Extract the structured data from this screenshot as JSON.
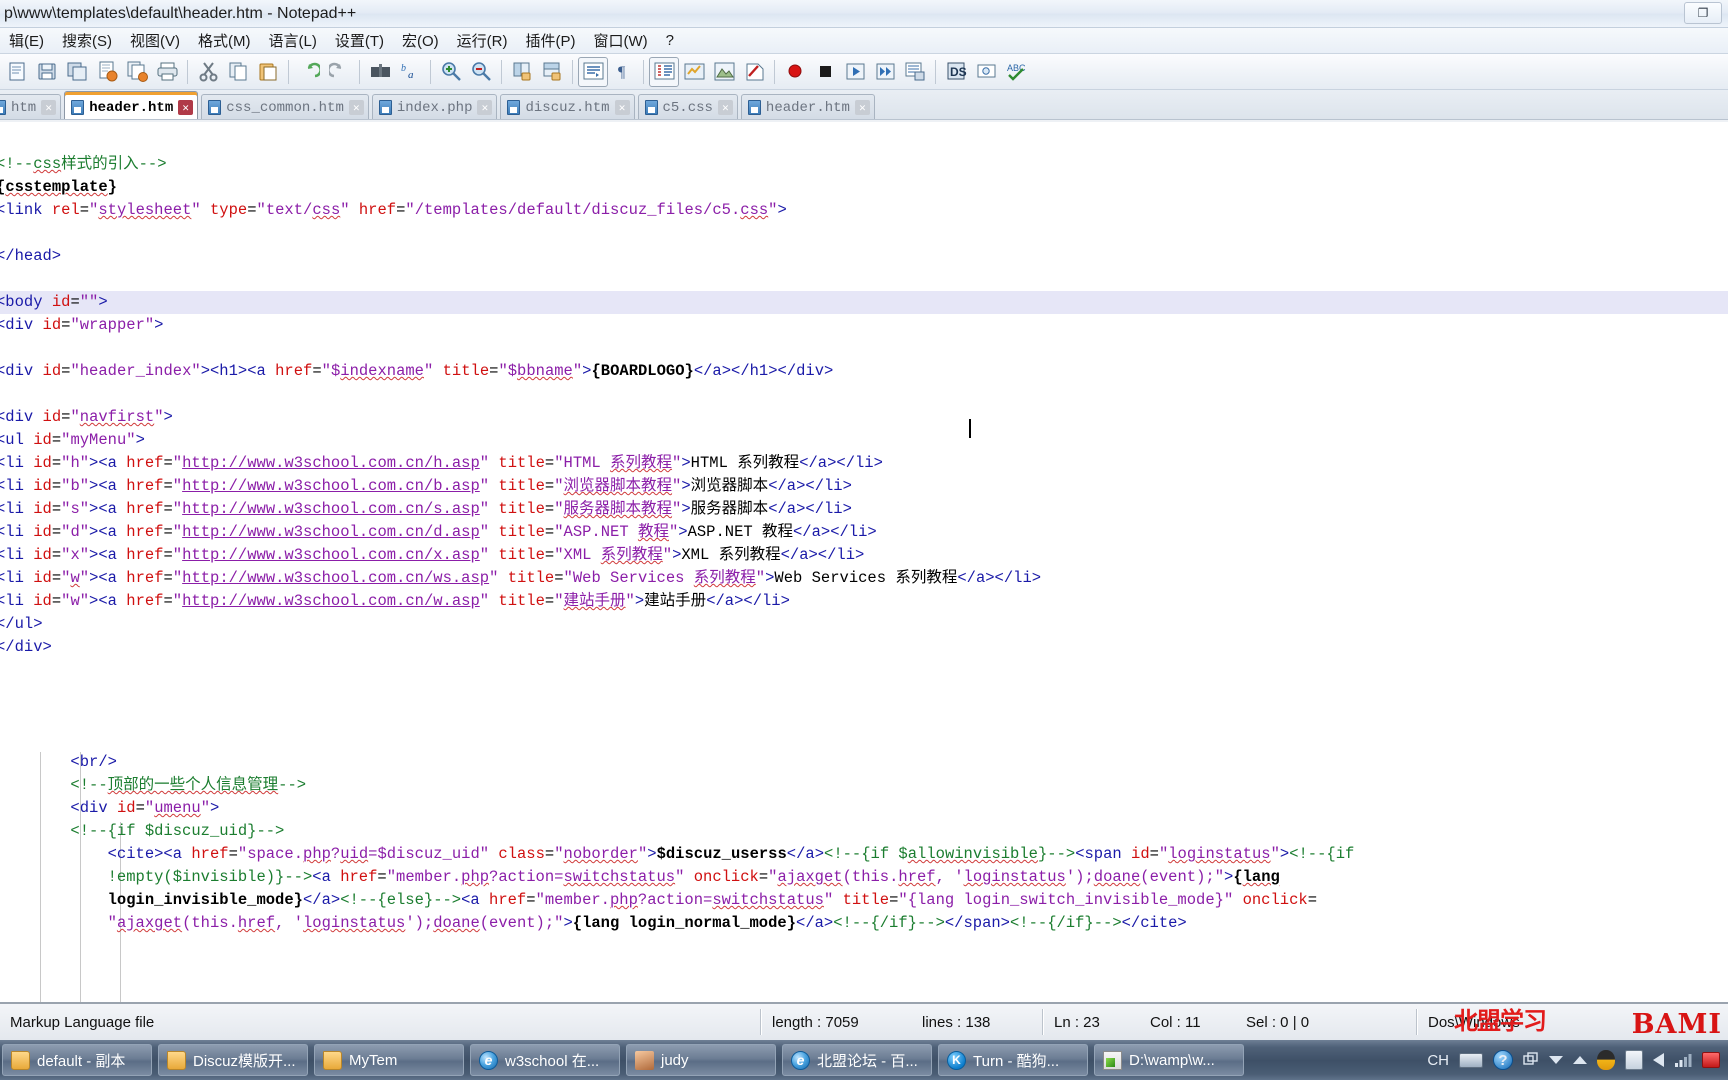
{
  "window": {
    "title": "p\\www\\templates\\default\\header.htm - Notepad++",
    "restore_label": "❐"
  },
  "menu": {
    "items": [
      {
        "label": "辑(E)",
        "name": "menu-edit"
      },
      {
        "label": "搜索(S)",
        "name": "menu-search"
      },
      {
        "label": "视图(V)",
        "name": "menu-view"
      },
      {
        "label": "格式(M)",
        "name": "menu-format"
      },
      {
        "label": "语言(L)",
        "name": "menu-language"
      },
      {
        "label": "设置(T)",
        "name": "menu-settings"
      },
      {
        "label": "宏(O)",
        "name": "menu-macro"
      },
      {
        "label": "运行(R)",
        "name": "menu-run"
      },
      {
        "label": "插件(P)",
        "name": "menu-plugins"
      },
      {
        "label": "窗口(W)",
        "name": "menu-window"
      },
      {
        "label": "?",
        "name": "menu-help"
      }
    ]
  },
  "toolbar": {
    "buttons": [
      "new-file-icon",
      "save-icon",
      "save-all-icon",
      "close-file-icon",
      "close-all-icon",
      "print-icon",
      "cut-icon",
      "copy-icon",
      "paste-icon",
      "undo-icon",
      "redo-icon",
      "find-icon",
      "replace-icon",
      "zoom-in-icon",
      "zoom-out-icon",
      "sync-vertical-icon",
      "sync-horizontal-icon",
      "word-wrap-icon",
      "show-all-chars-icon",
      "indent-guide-icon",
      "user-define-dialog-icon",
      "document-map-icon",
      "function-list-icon",
      "record-macro-icon",
      "stop-record-icon",
      "playback-icon",
      "run-multiple-icon",
      "save-macro-icon",
      "document-switcher-icon",
      "preview-icon",
      "spell-check-icon"
    ]
  },
  "tabs": [
    {
      "label": "htm",
      "active": false,
      "name": "tab-htm-partial"
    },
    {
      "label": "header.htm",
      "active": true,
      "name": "tab-header-htm"
    },
    {
      "label": "css_common.htm",
      "active": false,
      "name": "tab-css-common-htm"
    },
    {
      "label": "index.php",
      "active": false,
      "name": "tab-index-php"
    },
    {
      "label": "discuz.htm",
      "active": false,
      "name": "tab-discuz-htm"
    },
    {
      "label": "c5.css",
      "active": false,
      "name": "tab-c5-css"
    },
    {
      "label": "header.htm",
      "active": false,
      "name": "tab-header-htm-2"
    }
  ],
  "editor": {
    "lines": [
      {
        "current": false,
        "html": "",
        "indent": 0
      },
      {
        "current": false,
        "html": "<span class='c-cmt'>&lt;!--<span class='squig'>css</span>样式的引入--&gt;</span>"
      },
      {
        "current": false,
        "html": "<span class='c-ent'>{<span class='squig'>csstemplate</span>}</span>"
      },
      {
        "current": false,
        "html": "<span class='c-tag'>&lt;link</span> <span class='c-attr'>rel</span>=<span class='c-val'>\"<span class='squig'>stylesheet</span>\"</span> <span class='c-attr'>type</span>=<span class='c-val'>\"text/<span class='squig'>css</span>\"</span> <span class='c-attr'>href</span>=<span class='c-val'>\"/templates/default/discuz_files/c5.<span class='squig'>css</span>\"</span><span class='c-tag'>&gt;</span>"
      },
      {
        "current": false,
        "html": ""
      },
      {
        "current": false,
        "html": "<span class='c-tag'>&lt;/head&gt;</span>"
      },
      {
        "current": false,
        "html": ""
      },
      {
        "current": true,
        "html": "<span class='c-tag'>&lt;body</span> <span class='c-attr'>id</span>=<span class='c-val'>\"\"</span><span class='c-tag'>&gt;</span>"
      },
      {
        "current": false,
        "html": "<span class='c-tag'>&lt;div</span> <span class='c-attr'>id</span>=<span class='c-val'>\"wrapper\"</span><span class='c-tag'>&gt;</span>"
      },
      {
        "current": false,
        "html": ""
      },
      {
        "current": false,
        "html": "<span class='c-tag'>&lt;div</span> <span class='c-attr'>id</span>=<span class='c-val'>\"header_index\"</span><span class='c-tag'>&gt;&lt;h1&gt;&lt;a</span> <span class='c-attr'>href</span>=<span class='c-val'>\"$<span class='squig'>indexname</span>\"</span> <span class='c-attr'>title</span>=<span class='c-val'>\"$<span class='squig'>bbname</span>\"</span><span class='c-tag'>&gt;</span><span class='c-ent'>{BOARDLOGO}</span><span class='c-tag'>&lt;/a&gt;&lt;/h1&gt;&lt;/div&gt;</span>"
      },
      {
        "current": false,
        "html": ""
      },
      {
        "current": false,
        "html": "<span class='c-tag'>&lt;div</span> <span class='c-attr'>id</span>=<span class='c-val'>\"<span class='squig'>navfirst</span>\"</span><span class='c-tag'>&gt;</span>"
      },
      {
        "current": false,
        "html": "<span class='c-tag'>&lt;ul</span> <span class='c-attr'>id</span>=<span class='c-val'>\"myMenu\"</span><span class='c-tag'>&gt;</span>"
      },
      {
        "current": false,
        "html": "<span class='c-tag'>&lt;li</span> <span class='c-attr'>id</span>=<span class='c-val'>\"h\"</span><span class='c-tag'>&gt;&lt;a</span> <span class='c-attr'>href</span>=<span class='c-val'>\"<span class='uline'>http://www.w3school.com.cn/h.asp</span>\"</span> <span class='c-attr'>title</span>=<span class='c-val'>\"HTML <span class='squig'>系列教程</span>\"</span><span class='c-tag'>&gt;</span><span class='c-txt'>HTML 系列教程</span><span class='c-tag'>&lt;/a&gt;&lt;/li&gt;</span>"
      },
      {
        "current": false,
        "html": "<span class='c-tag'>&lt;li</span> <span class='c-attr'>id</span>=<span class='c-val'>\"b\"</span><span class='c-tag'>&gt;&lt;a</span> <span class='c-attr'>href</span>=<span class='c-val'>\"<span class='uline'>http://www.w3school.com.cn/b.asp</span>\"</span> <span class='c-attr'>title</span>=<span class='c-val'>\"<span class='squig'>浏览器脚本教程</span>\"</span><span class='c-tag'>&gt;</span><span class='c-txt'>浏览器脚本</span><span class='c-tag'>&lt;/a&gt;&lt;/li&gt;</span>"
      },
      {
        "current": false,
        "html": "<span class='c-tag'>&lt;li</span> <span class='c-attr'>id</span>=<span class='c-val'>\"s\"</span><span class='c-tag'>&gt;&lt;a</span> <span class='c-attr'>href</span>=<span class='c-val'>\"<span class='uline'>http://www.w3school.com.cn/s.asp</span>\"</span> <span class='c-attr'>title</span>=<span class='c-val'>\"<span class='squig'>服务器脚本教程</span>\"</span><span class='c-tag'>&gt;</span><span class='c-txt'>服务器脚本</span><span class='c-tag'>&lt;/a&gt;&lt;/li&gt;</span>"
      },
      {
        "current": false,
        "html": "<span class='c-tag'>&lt;li</span> <span class='c-attr'>id</span>=<span class='c-val'>\"d\"</span><span class='c-tag'>&gt;&lt;a</span> <span class='c-attr'>href</span>=<span class='c-val'>\"<span class='uline'>http://www.w3school.com.cn/d.asp</span>\"</span> <span class='c-attr'>title</span>=<span class='c-val'>\"ASP.NET <span class='squig'>教程</span>\"</span><span class='c-tag'>&gt;</span><span class='c-txt'>ASP.NET 教程</span><span class='c-tag'>&lt;/a&gt;&lt;/li&gt;</span>"
      },
      {
        "current": false,
        "html": "<span class='c-tag'>&lt;li</span> <span class='c-attr'>id</span>=<span class='c-val'>\"x\"</span><span class='c-tag'>&gt;&lt;a</span> <span class='c-attr'>href</span>=<span class='c-val'>\"<span class='uline'>http://www.w3school.com.cn/x.asp</span>\"</span> <span class='c-attr'>title</span>=<span class='c-val'>\"XML <span class='squig'>系列教程</span>\"</span><span class='c-tag'>&gt;</span><span class='c-txt'>XML 系列教程</span><span class='c-tag'>&lt;/a&gt;&lt;/li&gt;</span>"
      },
      {
        "current": false,
        "html": "<span class='c-tag'>&lt;li</span> <span class='c-attr'>id</span>=<span class='c-val'>\"<span class='squig'>w</span>\"</span><span class='c-tag'>&gt;&lt;a</span> <span class='c-attr'>href</span>=<span class='c-val'>\"<span class='uline'>http://www.w3school.com.cn/ws.asp</span>\"</span> <span class='c-attr'>title</span>=<span class='c-val'>\"Web Services <span class='squig'>系列教程</span>\"</span><span class='c-tag'>&gt;</span><span class='c-txt'>Web Services 系列教程</span><span class='c-tag'>&lt;/a&gt;&lt;/li&gt;</span>"
      },
      {
        "current": false,
        "html": "<span class='c-tag'>&lt;li</span> <span class='c-attr'>id</span>=<span class='c-val'>\"w\"</span><span class='c-tag'>&gt;&lt;a</span> <span class='c-attr'>href</span>=<span class='c-val'>\"<span class='uline'>http://www.w3school.com.cn/w.asp</span>\"</span> <span class='c-attr'>title</span>=<span class='c-val'>\"<span class='squig'>建站手册</span>\"</span><span class='c-tag'>&gt;</span><span class='c-txt'>建站手册</span><span class='c-tag'>&lt;/a&gt;&lt;/li&gt;</span>"
      },
      {
        "current": false,
        "html": "<span class='c-tag'>&lt;/ul&gt;</span>"
      },
      {
        "current": false,
        "html": "<span class='c-tag'>&lt;/div&gt;</span>"
      },
      {
        "current": false,
        "html": ""
      },
      {
        "current": false,
        "html": ""
      },
      {
        "current": false,
        "html": ""
      },
      {
        "current": false,
        "html": ""
      },
      {
        "current": false,
        "html": "        <span class='c-tag'>&lt;br/&gt;</span>"
      },
      {
        "current": false,
        "html": "        <span class='c-cmt'>&lt;!--<span class='squig'>顶部的一些个人信息管理</span>--&gt;</span>"
      },
      {
        "current": false,
        "html": "        <span class='c-tag'>&lt;div</span> <span class='c-attr'>id</span>=<span class='c-val'>\"<span class='squig'>umenu</span>\"</span><span class='c-tag'>&gt;</span>"
      },
      {
        "current": false,
        "html": "        <span class='c-cmt'>&lt;!--{if $discuz_uid}--&gt;</span>"
      },
      {
        "current": false,
        "html": "            <span class='c-tag'>&lt;cite&gt;&lt;a</span> <span class='c-attr'>href</span>=<span class='c-val'>\"space.<span class='squig'>php</span>?<span class='squig'>uid</span>=$discuz_uid\"</span> <span class='c-attr'>class</span>=<span class='c-val'>\"<span class='squig'>noborder</span>\"</span><span class='c-tag'>&gt;</span><span class='c-ent'>$discuz_userss</span><span class='c-tag'>&lt;/a&gt;</span><span class='c-cmt'>&lt;!--{if $<span class='squig'>allowinvisible</span>}--&gt;</span><span class='c-tag'>&lt;span</span> <span class='c-attr'>id</span>=<span class='c-val'>\"<span class='squig'>loginstatus</span>\"</span><span class='c-tag'>&gt;</span><span class='c-cmt'>&lt;!--{if</span>"
      },
      {
        "current": false,
        "html": "            <span class='c-cmt'>!empty($invisible)}--&gt;</span><span class='c-tag'>&lt;a</span> <span class='c-attr'>href</span>=<span class='c-val'>\"member.<span class='squig'>php</span>?action=<span class='squig'>switchstatus</span>\"</span> <span class='c-attr'>onclick</span>=<span class='c-val'>\"<span class='squig'>ajaxget</span>(this.<span class='squig'>href</span>, '<span class='squig'>loginstatus</span>');<span class='squig'>doane</span>(event);\"</span><span class='c-tag'>&gt;</span><span class='c-ent'>{<span class='squig'>lang</span></span>"
      },
      {
        "current": false,
        "html": "            <span class='c-ent'>login_invisible_mode}</span><span class='c-tag'>&lt;/a&gt;</span><span class='c-cmt'>&lt;!--{else}--&gt;</span><span class='c-tag'>&lt;a</span> <span class='c-attr'>href</span>=<span class='c-val'>\"member.<span class='squig'>php</span>?action=<span class='squig'>switchstatus</span>\"</span> <span class='c-attr'>title</span>=<span class='c-val'>\"{lang login_switch_invisible_mode}\"</span> <span class='c-attr'>onclick</span>="
      },
      {
        "current": false,
        "html": "            <span class='c-val'>\"<span class='squig'>ajaxget</span>(this.<span class='squig'>href</span>, '<span class='squig'>loginstatus</span>');<span class='squig'>doane</span>(event);\"</span><span class='c-tag'>&gt;</span><span class='c-ent'>{lang login_normal_mode}</span><span class='c-tag'>&lt;/a&gt;</span><span class='c-cmt'>&lt;!--{/if}--&gt;</span><span class='c-tag'>&lt;/span&gt;</span><span class='c-cmt'>&lt;!--{/if}--&gt;</span><span class='c-tag'>&lt;/cite&gt;</span>"
      }
    ]
  },
  "statusbar": {
    "doc_type": "Markup Language file",
    "length_label": "length : 7059",
    "lines_label": "lines : 138",
    "ln": "Ln : 23",
    "col": "Col : 11",
    "sel": "Sel : 0 | 0",
    "eol": "Dos\\Windows",
    "watermark_cn": "北盟学习",
    "watermark_en": "BAMI"
  },
  "taskbar": {
    "buttons": [
      {
        "label": "default - 副本",
        "icon": "folder-icon",
        "name": "taskbar-default-copy"
      },
      {
        "label": "Discuz模版开...",
        "icon": "folder-icon",
        "name": "taskbar-discuz-template"
      },
      {
        "label": "MyTem",
        "icon": "folder-icon",
        "name": "taskbar-mytem"
      },
      {
        "label": "w3school 在...",
        "icon": "ie-icon",
        "name": "taskbar-w3school"
      },
      {
        "label": "judy",
        "icon": "photo-icon",
        "name": "taskbar-judy"
      },
      {
        "label": "北盟论坛 - 百...",
        "icon": "ie-icon",
        "name": "taskbar-beimeng-forum"
      },
      {
        "label": "Turn - 酷狗...",
        "icon": "kugou-icon",
        "name": "taskbar-kugou-turn"
      },
      {
        "label": "D:\\wamp\\w...",
        "icon": "notepadpp-icon",
        "name": "taskbar-notepadpp"
      }
    ],
    "tray": {
      "ime": "CH",
      "icons": [
        "keyboard-icon",
        "help-icon",
        "window-switch-icon",
        "show-hidden-icon",
        "qq-penguin-icon",
        "clipboard-icon",
        "volume-icon",
        "network-icon",
        "shield-icon"
      ]
    }
  },
  "colors": {
    "accent_tab": "#f0a030",
    "tag": "#1a1aa8",
    "attribute": "#d01010",
    "value": "#8b1ea8",
    "comment": "#1b7d2f",
    "current_line": "#e6e6f7",
    "taskbar": "#3e5067",
    "watermark": "#d81414"
  }
}
